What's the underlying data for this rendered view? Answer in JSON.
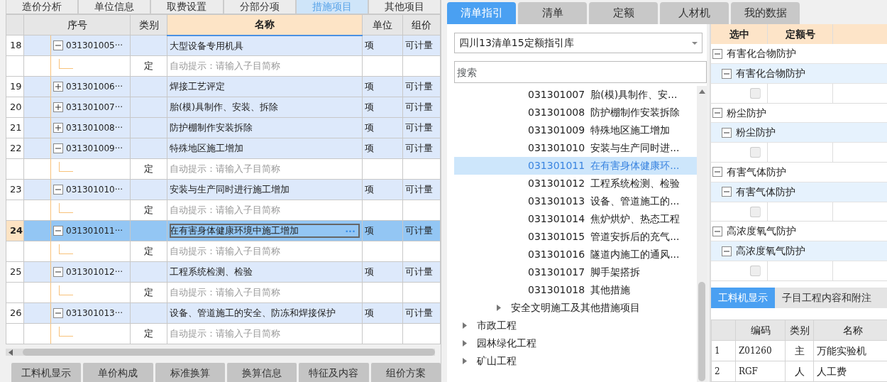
{
  "top_tabs": [
    {
      "label": "造价分析",
      "selected": false
    },
    {
      "label": "单位信息",
      "selected": false
    },
    {
      "label": "取费设置",
      "selected": false
    },
    {
      "label": "分部分项",
      "selected": false
    },
    {
      "label": "措施项目",
      "selected": true
    },
    {
      "label": "其他项目",
      "selected": false
    }
  ],
  "grid": {
    "columns": [
      "序号",
      "类别",
      "名称",
      "单位",
      "组价"
    ],
    "edit_button_label": "···",
    "rows": [
      {
        "kind": "item",
        "number": "18",
        "code": "031301005···",
        "expanded": true,
        "name": "大型设备专用机具",
        "unit": "项",
        "pricing": "可计量",
        "selected": false
      },
      {
        "kind": "sub",
        "type": "定",
        "placeholder": "自动提示：请输入子目简称"
      },
      {
        "kind": "item",
        "number": "19",
        "code": "031301006···",
        "expanded": false,
        "name": "焊接工艺评定",
        "unit": "项",
        "pricing": "可计量",
        "selected": false
      },
      {
        "kind": "item",
        "number": "20",
        "code": "031301007···",
        "expanded": false,
        "name": "胎(模)具制作、安装、拆除",
        "unit": "项",
        "pricing": "可计量",
        "selected": false
      },
      {
        "kind": "item",
        "number": "21",
        "code": "031301008···",
        "expanded": false,
        "name": "防护棚制作安装拆除",
        "unit": "项",
        "pricing": "可计量",
        "selected": false
      },
      {
        "kind": "item",
        "number": "22",
        "code": "031301009···",
        "expanded": true,
        "name": "特殊地区施工增加",
        "unit": "项",
        "pricing": "可计量",
        "selected": false
      },
      {
        "kind": "sub",
        "type": "定",
        "placeholder": "自动提示：请输入子目简称"
      },
      {
        "kind": "item",
        "number": "23",
        "code": "031301010···",
        "expanded": true,
        "name": "安装与生产同时进行施工增加",
        "unit": "项",
        "pricing": "可计量",
        "selected": false
      },
      {
        "kind": "sub",
        "type": "定",
        "placeholder": "自动提示：请输入子目简称"
      },
      {
        "kind": "item",
        "number": "24",
        "code": "031301011···",
        "expanded": true,
        "name": "在有害身体健康环境中施工增加",
        "unit": "项",
        "pricing": "可计量",
        "selected": true
      },
      {
        "kind": "sub",
        "type": "定",
        "placeholder": "自动提示：请输入子目简称"
      },
      {
        "kind": "item",
        "number": "25",
        "code": "031301012···",
        "expanded": true,
        "name": "工程系统检测、检验",
        "unit": "项",
        "pricing": "可计量",
        "selected": false
      },
      {
        "kind": "sub",
        "type": "定",
        "placeholder": "自动提示：请输入子目简称"
      },
      {
        "kind": "item",
        "number": "26",
        "code": "031301013···",
        "expanded": true,
        "name": "设备、管道施工的安全、防冻和焊接保护",
        "unit": "项",
        "pricing": "可计量",
        "selected": false
      },
      {
        "kind": "sub",
        "type": "定",
        "placeholder": "自动提示：请输入子目简称"
      }
    ]
  },
  "bottom_tabs": [
    "工料机显示",
    "单价构成",
    "标准换算",
    "换算信息",
    "特征及内容",
    "组价方案"
  ],
  "right_tabs": [
    {
      "label": "清单指引",
      "selected": true
    },
    {
      "label": "清单",
      "selected": false
    },
    {
      "label": "定额",
      "selected": false
    },
    {
      "label": "人材机",
      "selected": false
    },
    {
      "label": "我的数据",
      "selected": false
    }
  ],
  "guide": {
    "library": "四川13清单15定额指引库",
    "search": {
      "placeholder": "搜索"
    },
    "items": [
      {
        "code": "031301007",
        "name": "胎(模)具制作、安...",
        "selected": false
      },
      {
        "code": "031301008",
        "name": "防护棚制作安装拆除",
        "selected": false
      },
      {
        "code": "031301009",
        "name": "特殊地区施工增加",
        "selected": false
      },
      {
        "code": "031301010",
        "name": "安装与生产同时进...",
        "selected": false
      },
      {
        "code": "031301011",
        "name": "在有害身体健康环...",
        "selected": true
      },
      {
        "code": "031301012",
        "name": "工程系统检测、检验",
        "selected": false
      },
      {
        "code": "031301013",
        "name": "设备、管道施工的...",
        "selected": false
      },
      {
        "code": "031301014",
        "name": "焦炉烘炉、热态工程",
        "selected": false
      },
      {
        "code": "031301015",
        "name": "管道安拆后的充气...",
        "selected": false
      },
      {
        "code": "031301016",
        "name": "隧道内施工的通风...",
        "selected": false
      },
      {
        "code": "031301017",
        "name": "脚手架搭拆",
        "selected": false
      },
      {
        "code": "031301018",
        "name": "其他措施",
        "selected": false
      }
    ],
    "sibling_groups": [
      {
        "label": "安全文明施工及其他措施项目",
        "expanded": false
      }
    ],
    "top_groups": [
      {
        "label": "市政工程",
        "expanded": false
      },
      {
        "label": "园林绿化工程",
        "expanded": false
      },
      {
        "label": "矿山工程",
        "expanded": false
      }
    ]
  },
  "quota": {
    "columns": [
      "选中",
      "定额号"
    ],
    "groups": [
      {
        "label": "有害化合物防护",
        "expanded": true,
        "children": [
          {
            "label": "有害化合物防护",
            "expanded": true,
            "children": [
              {
                "checked": false
              }
            ]
          }
        ]
      },
      {
        "label": "粉尘防护",
        "expanded": true,
        "children": [
          {
            "label": "粉尘防护",
            "expanded": true,
            "children": [
              {
                "checked": false
              }
            ]
          }
        ]
      },
      {
        "label": "有害气体防护",
        "expanded": true,
        "children": [
          {
            "label": "有害气体防护",
            "expanded": true,
            "children": [
              {
                "checked": false
              }
            ]
          }
        ]
      },
      {
        "label": "高浓度氧气防护",
        "expanded": true,
        "children": [
          {
            "label": "高浓度氧气防护",
            "expanded": true,
            "children": [
              {
                "checked": false
              }
            ]
          }
        ]
      }
    ]
  },
  "detail": {
    "tabs": [
      {
        "label": "工料机显示",
        "selected": true
      },
      {
        "label": "子目工程内容和附注",
        "selected": false
      }
    ],
    "columns": [
      "",
      "编码",
      "类别",
      "名称"
    ],
    "rows": [
      [
        "1",
        "Z01260",
        "主",
        "万能实验机"
      ],
      [
        "2",
        "RGF",
        "人",
        "人工费"
      ]
    ]
  }
}
